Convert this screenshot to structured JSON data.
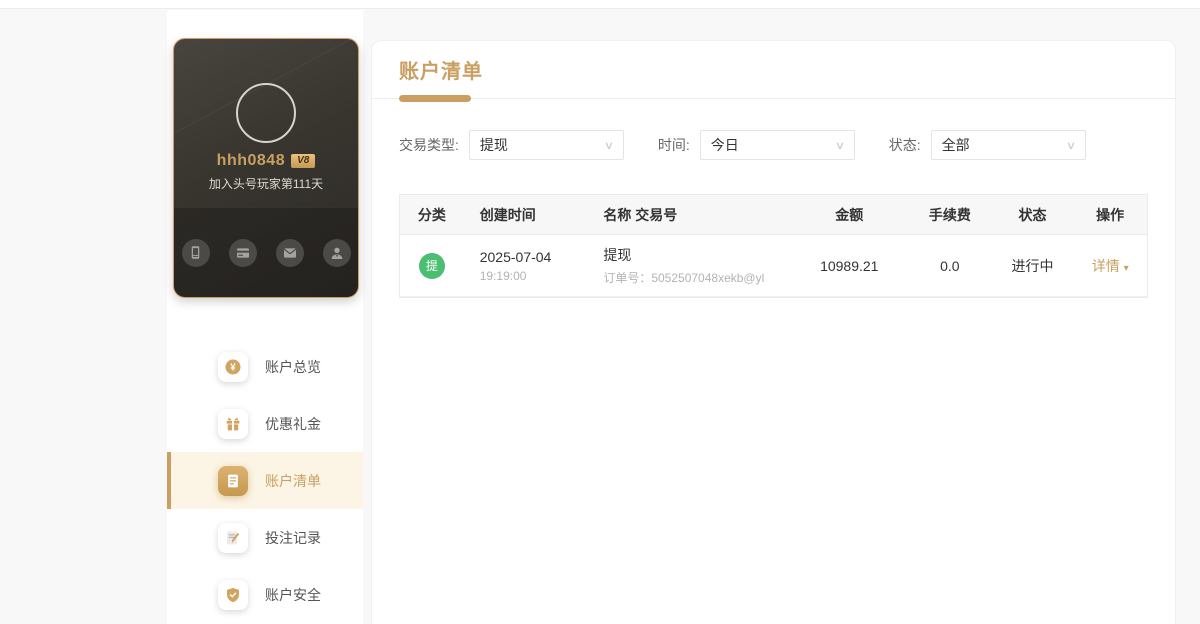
{
  "colors": {
    "gold": "#c9a062",
    "gold-light": "#ddb272",
    "green": "#4cbe71",
    "card-border": "#c59f63",
    "active-bg": "#fcf5e5"
  },
  "icons": {
    "chevron_down": "∨",
    "caret_down": "▾",
    "coin_symbol": "¥"
  },
  "profile": {
    "username": "hhh0848",
    "vip_badge": "V8",
    "join_text": "加入头号玩家第111天",
    "quick_actions": [
      "phone",
      "bank-card",
      "mail",
      "user"
    ]
  },
  "sidebar": {
    "items": [
      {
        "label": "账户总览",
        "icon": "coin-icon",
        "active": false
      },
      {
        "label": "优惠礼金",
        "icon": "gift-icon",
        "active": false
      },
      {
        "label": "账户清单",
        "icon": "statement-icon",
        "active": true
      },
      {
        "label": "投注记录",
        "icon": "bet-record-icon",
        "active": false
      },
      {
        "label": "账户安全",
        "icon": "shield-icon",
        "active": false
      }
    ]
  },
  "main": {
    "title": "账户清单",
    "filters": [
      {
        "label": "交易类型:",
        "value": "提现"
      },
      {
        "label": "时间:",
        "value": "今日"
      },
      {
        "label": "状态:",
        "value": "全部"
      }
    ],
    "table": {
      "headers": [
        "分类",
        "创建时间",
        "名称 交易号",
        "金额",
        "手续费",
        "状态",
        "操作"
      ],
      "rows": [
        {
          "category_badge": "提",
          "date": "2025-07-04",
          "time": "19:19:00",
          "name": "提现",
          "order_text": "订单号：5052507048xekb@yl",
          "amount": "10989.21",
          "fee": "0.0",
          "status": "进行中",
          "action": "详情"
        }
      ]
    }
  }
}
